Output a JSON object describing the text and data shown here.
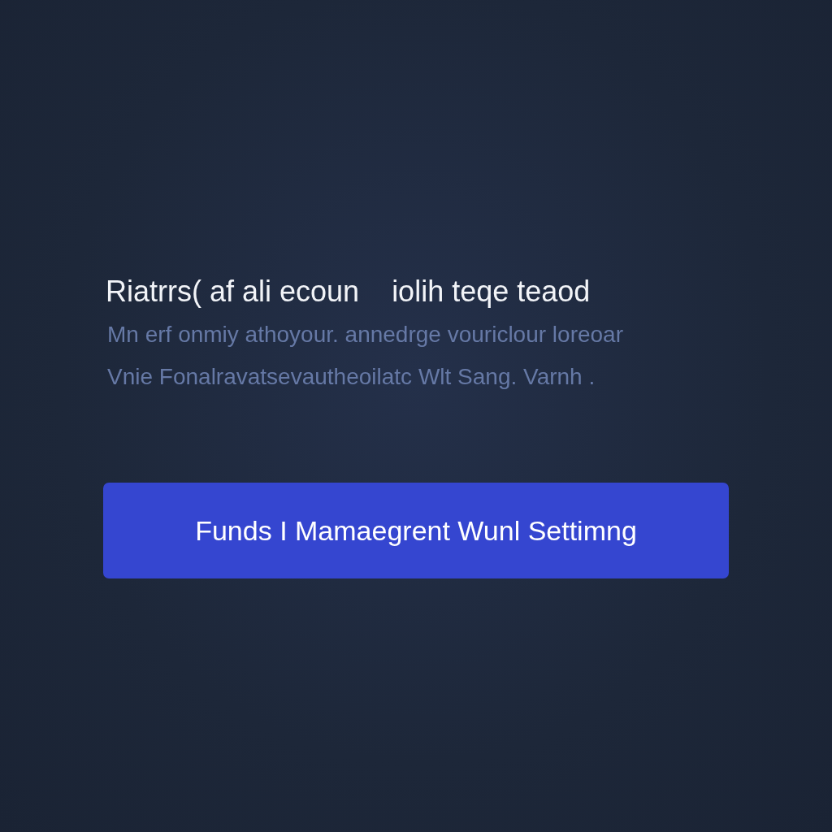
{
  "heading": "Riatrrs( af ali ecoun    iolih teqe teaod",
  "description": [
    "Mn erf onmiy athoyour. annedrge vouriclour loreoar",
    "Vnie Fonalravatsevautheoilatc Wlt Sang. Varnh ."
  ],
  "button": {
    "label": "Funds I Mamaegrent Wunl Settimng"
  }
}
